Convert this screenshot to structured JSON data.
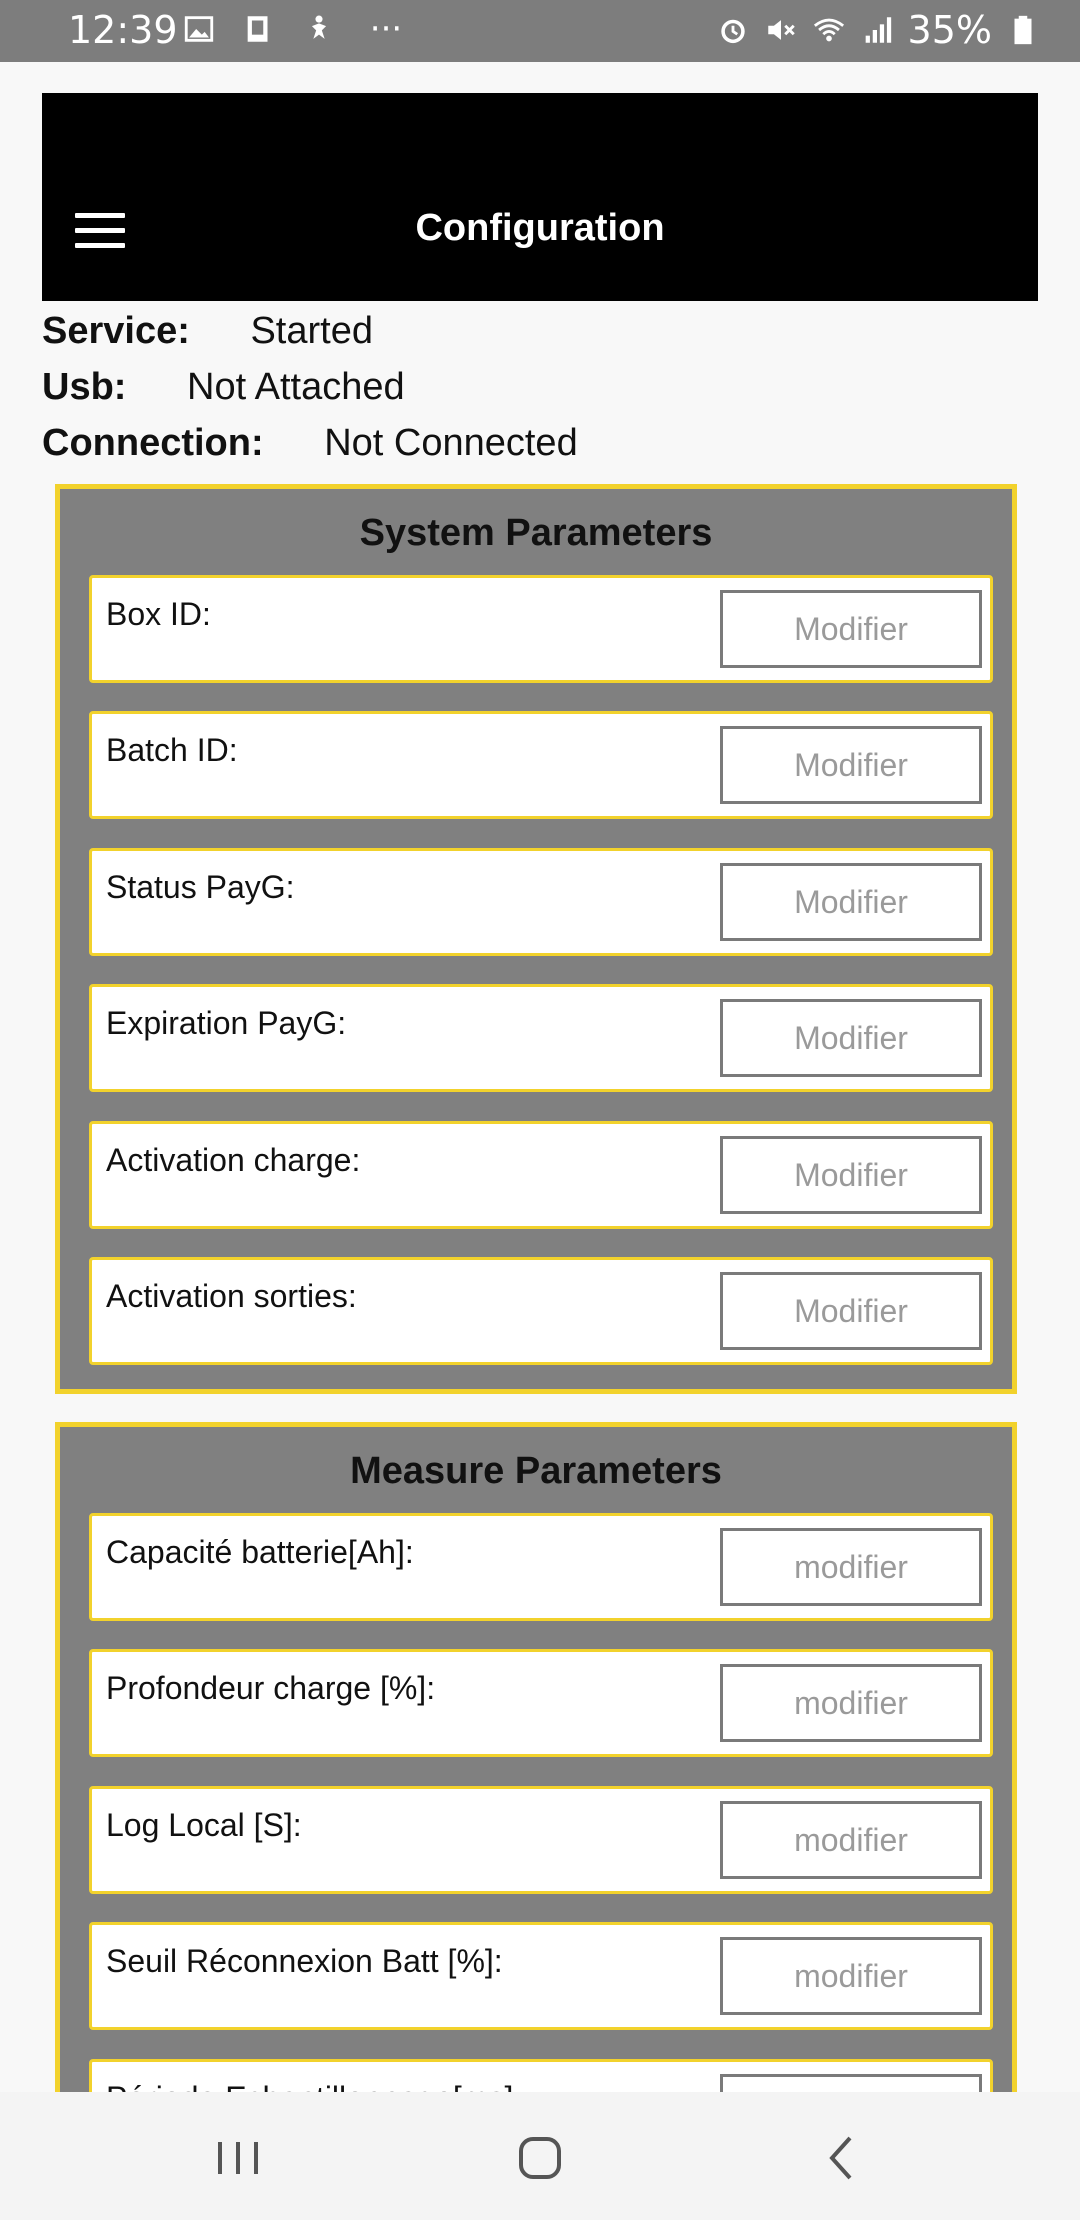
{
  "status_bar": {
    "time": "12:39",
    "overflow": "···",
    "battery_percent": "35%",
    "left_icons": [
      "gallery-icon",
      "device-icon",
      "accessibility-icon"
    ],
    "right_icons": [
      "alarm-icon",
      "mute-icon",
      "wifi-icon",
      "signal-icon",
      "battery-icon"
    ]
  },
  "app_bar": {
    "title": "Configuration",
    "menu_icon": "hamburger-menu-icon",
    "background": "#000000"
  },
  "status": [
    {
      "label": "Service:",
      "value": "Started"
    },
    {
      "label": "Usb:",
      "value": "Not Attached"
    },
    {
      "label": "Connection:",
      "value": "Not Connected"
    }
  ],
  "system_parameters": {
    "title": "System Parameters",
    "rows": [
      {
        "label": "Box ID:",
        "button": "Modifier"
      },
      {
        "label": "Batch ID:",
        "button": "Modifier"
      },
      {
        "label": "Status PayG:",
        "button": "Modifier"
      },
      {
        "label": "Expiration PayG:",
        "button": "Modifier"
      },
      {
        "label": "Activation charge:",
        "button": "Modifier"
      },
      {
        "label": "Activation sorties:",
        "button": "Modifier"
      }
    ]
  },
  "measure_parameters": {
    "title": "Measure Parameters",
    "rows": [
      {
        "label": "Capacité batterie[Ah]:",
        "button": "modifier"
      },
      {
        "label": "Profondeur charge [%]:",
        "button": "modifier"
      },
      {
        "label": "Log Local [S]:",
        "button": "modifier"
      },
      {
        "label": "Seuil Réconnexion Batt [%]:",
        "button": "modifier"
      },
      {
        "label": "Période Echantillonnage[ms]:",
        "button": ""
      }
    ]
  },
  "nav_bar": {
    "buttons": [
      "recents-icon",
      "home-icon",
      "back-icon"
    ]
  },
  "colors": {
    "accent_border": "#f2d22c",
    "panel_bg": "#808080",
    "status_bar_bg": "#7d7d7d"
  }
}
